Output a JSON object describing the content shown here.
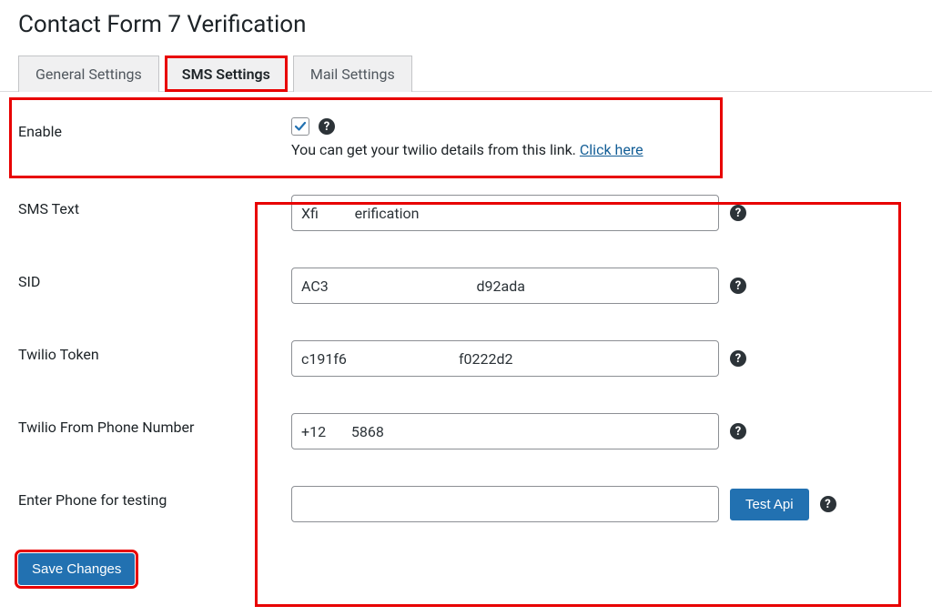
{
  "page": {
    "title": "Contact Form 7 Verification"
  },
  "tabs": [
    {
      "label": "General Settings"
    },
    {
      "label": "SMS Settings"
    },
    {
      "label": "Mail Settings"
    }
  ],
  "fields": {
    "enable": {
      "label": "Enable",
      "hint_prefix": "You can get your twilio details from this link. ",
      "link_text": "Click here"
    },
    "sms_text": {
      "label": "SMS Text",
      "value": "Xfi          erification"
    },
    "sid": {
      "label": "SID",
      "value": "AC3                                         d92ada"
    },
    "twilio_token": {
      "label": "Twilio Token",
      "value": "c191f6                               f0222d2"
    },
    "twilio_from": {
      "label": "Twilio From Phone Number",
      "value": "+12       5868"
    },
    "test_phone": {
      "label": "Enter Phone for testing",
      "value": "",
      "button": "Test Api"
    }
  },
  "buttons": {
    "save": "Save Changes"
  }
}
